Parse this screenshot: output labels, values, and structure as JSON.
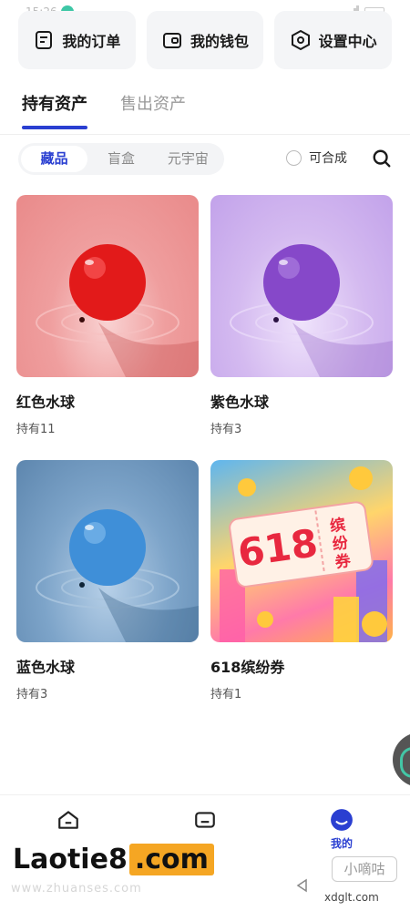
{
  "status": {
    "time": "15:26"
  },
  "quick_links": [
    {
      "label": "我的订单",
      "icon": "order-list-icon"
    },
    {
      "label": "我的钱包",
      "icon": "wallet-icon"
    },
    {
      "label": "设置中心",
      "icon": "settings-hex-icon"
    }
  ],
  "main_tabs": [
    {
      "label": "持有资产",
      "active": true
    },
    {
      "label": "售出资产",
      "active": false
    }
  ],
  "sub_tabs": [
    {
      "label": "藏品",
      "active": true
    },
    {
      "label": "盲盒",
      "active": false
    },
    {
      "label": "元宇宙",
      "active": false
    }
  ],
  "filter": {
    "mergeable_label": "可合成"
  },
  "items": [
    {
      "name": "红色水球",
      "count": "持有11",
      "image": "red-water-balloon"
    },
    {
      "name": "紫色水球",
      "count": "持有3",
      "image": "purple-water-balloon"
    },
    {
      "name": "蓝色水球",
      "count": "持有3",
      "image": "blue-water-balloon"
    },
    {
      "name": "618缤纷券",
      "count": "持有1",
      "image": "618-coupon"
    }
  ],
  "promo": {
    "big_number": "618",
    "side_text": "缤纷券"
  },
  "bottom_nav": [
    {
      "label": "",
      "icon": "home-icon",
      "active": false
    },
    {
      "label": "",
      "icon": "market-icon",
      "active": false
    },
    {
      "label": "我的",
      "icon": "profile-icon",
      "active": true
    }
  ],
  "watermarks": {
    "left_main": "Laotie8",
    "left_com": ".com",
    "left_sub": "www.zhuanses.com",
    "right_main": "小嘀咕",
    "right_sub": "xdglt.com"
  },
  "colors": {
    "accent": "#2a3fd1",
    "text": "#1a1a1a",
    "muted": "#999999"
  }
}
